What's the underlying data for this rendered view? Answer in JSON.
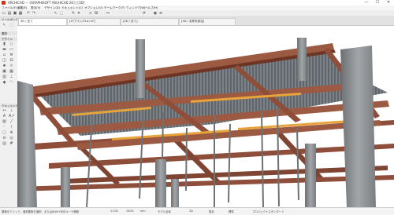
{
  "window": {
    "title": "ARCHICAD — [GRAPHISOFT ARCHICAD 26] | [3D]",
    "minimize": "—",
    "maximize": "☐",
    "close": "✕"
  },
  "menu": [
    "ファイル(F)",
    "編集(E)",
    "表示(V)",
    "デザイン(D)",
    "ドキュメント(C)",
    "オプション(O)",
    "チームワーク(T)",
    "ウィンドウ(W)",
    "ヘルプ(H)"
  ],
  "toolbar": {
    "icons": [
      "new-icon",
      "open-icon",
      "save-icon",
      "print-icon",
      "undo-icon",
      "redo-icon",
      "arrow-icon",
      "marquee-icon",
      "eyedropper-icon",
      "wand-icon",
      "magnet-icon",
      "grid-icon",
      "dims-icon",
      "orbit-icon",
      "view-icon",
      "layers-icon"
    ]
  },
  "tabs": [
    {
      "label": "3D / 全て"
    },
    {
      "label": "[1Fプラン/FL4=1F]"
    },
    {
      "label": "[3D / 全て]"
    },
    {
      "label": "[3D / 名称未設定]"
    }
  ],
  "leftpanel": {
    "head1": "ツールボックス",
    "head2": "選択",
    "head3": "デザイン",
    "head4": "ドキュメント"
  },
  "status": {
    "hint": "要素をクリック、選択要素を選択、またはShift+矢印キーで移動",
    "zoom": "1:100",
    "scale": "100%",
    "unit": "mm",
    "layer": "モデル全体",
    "view": "3D",
    "renovation": "既存",
    "mode": "標準",
    "pen": "プロジェクトスタンダード"
  },
  "colors": {
    "beam": "#9c5a43",
    "slab": "#6a6f73",
    "column": "#8e9194",
    "accent": "#e8a33a"
  }
}
